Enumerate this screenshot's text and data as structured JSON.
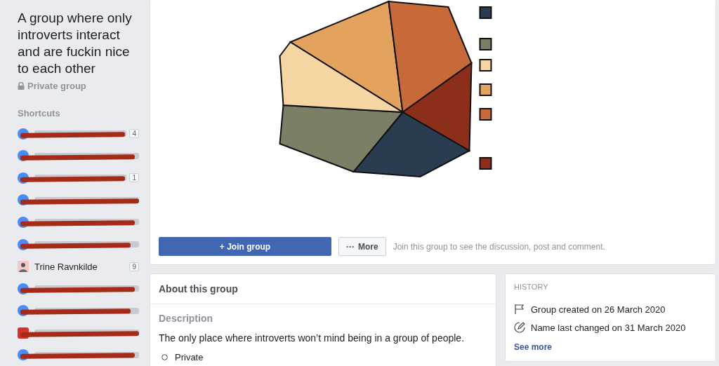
{
  "group": {
    "name": "A group where only introverts interact and are fuckin nice to each other",
    "privacy": "Private group"
  },
  "shortcuts": {
    "title": "Shortcuts",
    "items": [
      {
        "kind": "redacted",
        "badge": "4"
      },
      {
        "kind": "redacted"
      },
      {
        "kind": "redacted",
        "badge": "1"
      },
      {
        "kind": "redacted"
      },
      {
        "kind": "redacted"
      },
      {
        "kind": "redacted"
      },
      {
        "kind": "person",
        "label": "Trine Ravnkilde",
        "badge": "9"
      },
      {
        "kind": "redacted"
      },
      {
        "kind": "redacted"
      },
      {
        "kind": "redacted_page"
      },
      {
        "kind": "redacted"
      }
    ]
  },
  "actions": {
    "join": "+ Join group",
    "more_icon": "···",
    "more": "More",
    "hint": "Join this group to see the discussion, post and comment."
  },
  "about": {
    "title": "About this group",
    "description_label": "Description",
    "description": "The only place where introverts won’t mind being in a group of people.",
    "privacy": "Private"
  },
  "history": {
    "title": "HISTORY",
    "items": [
      {
        "kind": "created",
        "text": "Group created on 26 March 2020"
      },
      {
        "kind": "renamed",
        "text": "Name last changed on 31 March 2020"
      }
    ],
    "link": "See more"
  }
}
